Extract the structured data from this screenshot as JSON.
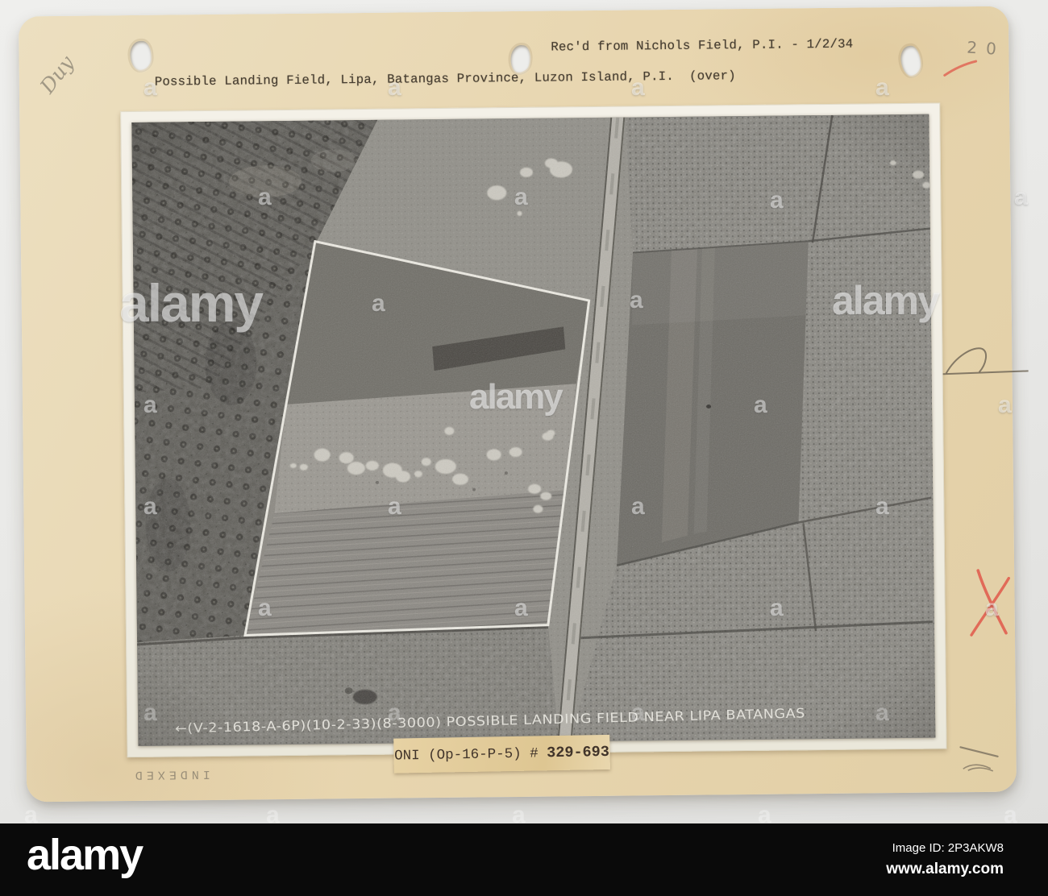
{
  "card": {
    "received_note": "Rec'd from Nichols Field, P.I. - 1/2/34",
    "caption_line": "Possible Landing Field, Lipa, Batangas Province, Luzon Island, P.I.  (over)",
    "pencil_initials": "Duy",
    "pencil_number": "20",
    "indexed_stamp": "INDEXED",
    "oni_label_prefix": "ONI (Op-16-P-5) # ",
    "oni_label_number": "329-693"
  },
  "photo": {
    "caption": "←(V-2-1618-A-6P)(10-2-33)(8-3000) POSSIBLE  LANDING  FIELD  NEAR  LIPA  BATANGAS"
  },
  "watermark": {
    "small": "a",
    "large": "alamy"
  },
  "footer": {
    "logo": "alamy",
    "image_id": "Image ID: 2P3AKW8",
    "url": "www.alamy.com"
  },
  "colors": {
    "card": "#e8d6b0",
    "mat": "#f3f0e7",
    "photo_base": "#908e87",
    "red_mark": "#e0584a",
    "footer_bar": "#0a0a0a"
  }
}
